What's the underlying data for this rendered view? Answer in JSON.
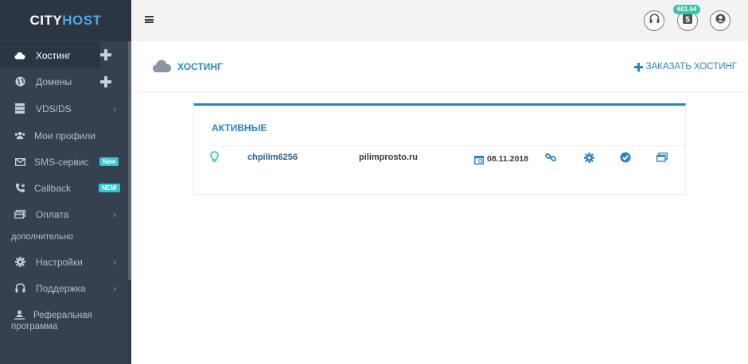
{
  "logo": {
    "part1": "CITY",
    "part2": "HOST"
  },
  "sidebar": {
    "items": [
      {
        "label": "Хостинг",
        "icon": "cloud-icon",
        "active": true,
        "has_plus": true
      },
      {
        "label": "Домены",
        "icon": "globe-icon",
        "has_plus": true
      },
      {
        "label": "VDS/DS",
        "icon": "server-icon",
        "has_chevron": true
      },
      {
        "label": "Мои профили",
        "icon": "users-icon"
      },
      {
        "label": "SMS-сервис",
        "icon": "envelope-icon",
        "badge": "New"
      },
      {
        "label": "Callback",
        "icon": "phone-icon",
        "badge": "NEW"
      },
      {
        "label": "Оплата",
        "icon": "credit-card-icon",
        "has_chevron": true
      },
      {
        "label": "Настройки",
        "icon": "gear-icon",
        "has_chevron": true
      },
      {
        "label": "Поддержка",
        "icon": "headset-icon",
        "has_chevron": true
      }
    ],
    "section_label": "дополнительно",
    "referral": {
      "line1": "Реферальная",
      "line2": "программа",
      "icon": "person-icon"
    }
  },
  "header": {
    "menu_icon": "hamburger-icon",
    "buttons": [
      "headset-icon",
      "dollar-icon",
      "user-icon"
    ],
    "balance": "601.64"
  },
  "page": {
    "title": "ХОСТИНГ",
    "order_button": "ЗАКАЗАТЬ ХОСТИНГ"
  },
  "card": {
    "title": "АКТИВНЫЕ",
    "rows": [
      {
        "status_icon": "lightbulb-icon",
        "login": "chpilim6256",
        "domain": "pilimprosto.ru",
        "date": "08.11.2018",
        "actions": [
          "link-icon",
          "gear-icon",
          "check-circle-icon",
          "window-icon"
        ]
      }
    ]
  },
  "colors": {
    "sidebar_bg": "#364150",
    "accent": "#2a84c4",
    "badge": "#36c6d3",
    "balance_badge": "#36c6a8"
  }
}
